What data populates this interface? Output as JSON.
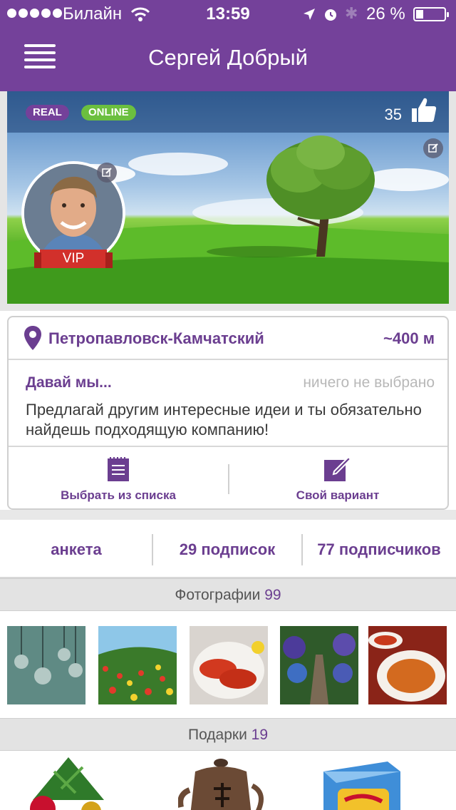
{
  "status_bar": {
    "carrier": "Билайн",
    "time": "13:59",
    "battery": "26 %"
  },
  "nav": {
    "title": "Сергей Добрый"
  },
  "profile": {
    "badge_real": "REAL",
    "badge_online": "ONLINE",
    "likes": "35",
    "vip_label": "VIP"
  },
  "location": {
    "city": "Петропавловск-Камчатский",
    "distance": "~400 м"
  },
  "idea": {
    "title": "Давай мы...",
    "selection": "ничего не выбрано",
    "description": "Предлагай другим интересные идеи и ты обязательно найдешь подходящую компанию!",
    "choose_label": "Выбрать из списка",
    "custom_label": "Свой вариант"
  },
  "stats": {
    "profile_tab": "анкета",
    "subscriptions": "29 подписок",
    "subscribers": "77 подписчиков"
  },
  "photos": {
    "label": "Фотографии",
    "count": "99"
  },
  "gifts": {
    "label": "Подарки",
    "count": "19"
  },
  "colors": {
    "brand": "#74419a",
    "online": "#6bbf3f",
    "vip": "#d2302b"
  }
}
